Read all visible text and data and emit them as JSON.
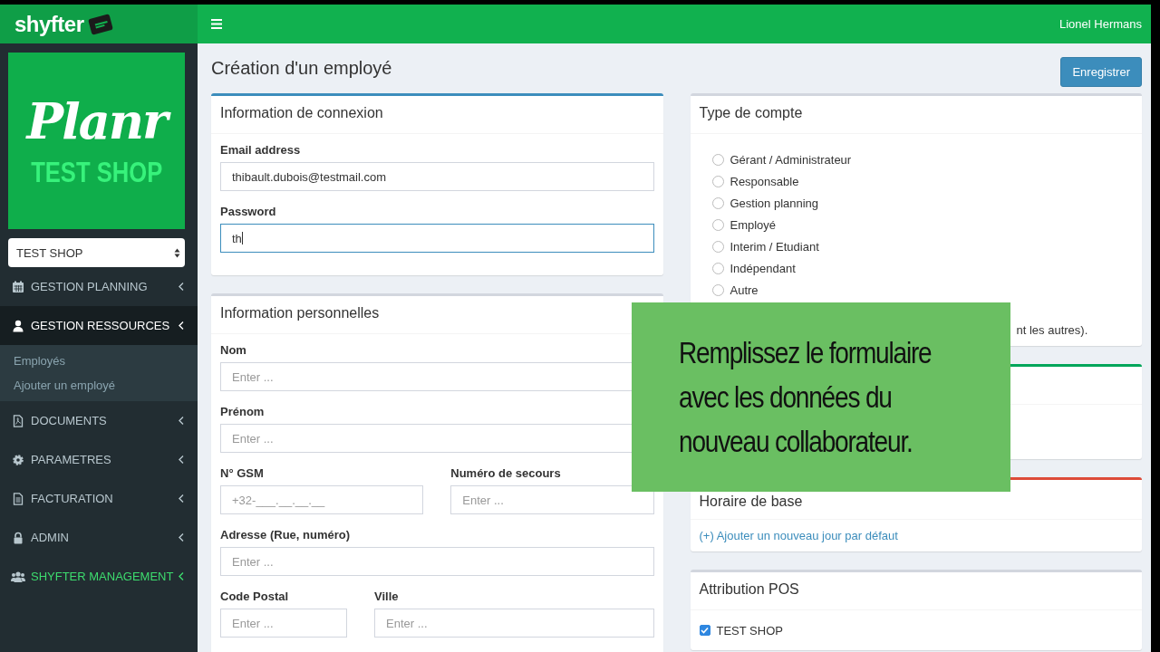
{
  "header": {
    "brand": "shyfter",
    "user": "Lionel Hermans"
  },
  "logo": {
    "script": "Planr",
    "shop": "TEST SHOP"
  },
  "shop_select": {
    "value": "TEST SHOP"
  },
  "sidebar": {
    "items": [
      {
        "label": "GESTION PLANNING",
        "expanded": false
      },
      {
        "label": "GESTION RESSOURCES",
        "expanded": true,
        "children": [
          {
            "label": "Employés"
          },
          {
            "label": "Ajouter un employé"
          }
        ]
      },
      {
        "label": "DOCUMENTS",
        "expanded": false
      },
      {
        "label": "PARAMETRES",
        "expanded": false
      },
      {
        "label": "FACTURATION",
        "expanded": false
      },
      {
        "label": "ADMIN",
        "expanded": false
      },
      {
        "label": "SHYFTER MANAGEMENT",
        "expanded": false,
        "color": "#3ddc6e"
      }
    ]
  },
  "page": {
    "title": "Création d'un employé",
    "save_button": "Enregistrer"
  },
  "connexion": {
    "title": "Information de connexion",
    "fields": [
      {
        "label": "Email address",
        "value": "thibault.dubois@testmail.com",
        "focused": false
      },
      {
        "label": "Password",
        "value": "th",
        "focused": true
      }
    ]
  },
  "personnelles": {
    "title": "Information personnelles",
    "rows": [
      [
        {
          "label": "Nom",
          "placeholder": "Enter ..."
        }
      ],
      [
        {
          "label": "Prénom",
          "placeholder": "Enter ..."
        }
      ],
      [
        {
          "label": "N° GSM",
          "placeholder": "+32-___.__.__.__"
        },
        {
          "label": "Numéro de secours",
          "placeholder": "Enter ..."
        }
      ],
      [
        {
          "label": "Adresse (Rue, numéro)",
          "placeholder": "Enter ..."
        }
      ],
      [
        {
          "label": "Code Postal",
          "placeholder": "Enter ..."
        },
        {
          "label": "Ville",
          "placeholder": "Enter ..."
        }
      ]
    ]
  },
  "type_compte": {
    "title": "Type de compte",
    "options": [
      {
        "label": "Gérant / Administrateur",
        "selected": false
      },
      {
        "label": "Responsable",
        "selected": false
      },
      {
        "label": "Gestion planning",
        "selected": false
      },
      {
        "label": "Employé",
        "selected": false
      },
      {
        "label": "Interim / Etudiant",
        "selected": false
      },
      {
        "label": "Indépendant",
        "selected": false
      },
      {
        "label": "Autre",
        "selected": false
      }
    ],
    "note": "nt les autres)."
  },
  "hidden_card": {
    "color": "#00a65a"
  },
  "horaire": {
    "title": "Horaire de base",
    "color": "#dd4b39",
    "link": "(+) Ajouter un nouveau jour par défaut"
  },
  "pos": {
    "title": "Attribution POS",
    "items": [
      {
        "label": "TEST SHOP",
        "checked": true
      }
    ]
  },
  "overlay": {
    "lines": [
      "Remplissez le formulaire",
      "avec les données du",
      "nouveau collaborateur."
    ]
  }
}
